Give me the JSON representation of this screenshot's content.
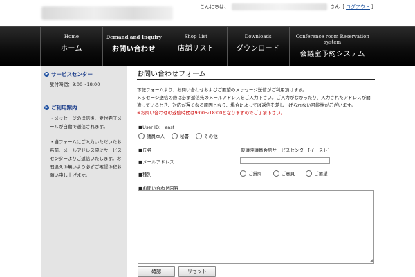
{
  "header": {
    "greeting_prefix": "こんにちは、",
    "greeting_suffix": "さん",
    "logout": "ログアウト"
  },
  "nav": [
    {
      "en": "Home",
      "jp": "ホーム",
      "active": false
    },
    {
      "en": "Demand and Inquiry",
      "jp": "お問い合わせ",
      "active": true
    },
    {
      "en": "Shop List",
      "jp": "店舗リスト",
      "active": false
    },
    {
      "en": "Downloads",
      "jp": "ダウンロード",
      "active": false
    },
    {
      "en": "Conference room Reservation system",
      "jp": "会議室予約システム",
      "active": false
    }
  ],
  "sidebar": {
    "service_center": {
      "title": "サービスセンター",
      "hours": "受付時間：9:00～18:00"
    },
    "guide": {
      "title": "ご利用案内",
      "note1": "・メッセージの送信後、受付完了メールが自動で送信されます。",
      "note2": "・当フォームにご入力いただいたお名前、メールアドレス宛にサービスセンターよりご返信いたします。お間違えの無いよう必ずご確認の程お願い申し上げます。"
    }
  },
  "form": {
    "title": "お問い合わせフォーム",
    "intro_line1": "下記フォームより、お問い合わせおよびご要望のメッセージ送信がご利用頂けます。",
    "intro_line2": "メッセージ送信の際は必ず返信先のメールアドレスをご入力下さい。ご入力がなかったり、入力されたアドレスが間違っているとき、対応が遅くなる原因となり、場合によっては返信を差し上げられない可能性がございます。",
    "intro_red": "※お問い合わせの返信時間は9:00～18:00となりますのでご了承下さい。",
    "user_id_label": "■User ID:",
    "user_id_value": "east",
    "user_type_options": [
      "議員本人",
      "秘書",
      "その他"
    ],
    "name_label": "■氏名",
    "name_value": "衆議院議員会館サービスセンター[イースト]",
    "email_label": "■メールアドレス",
    "email_value": "",
    "category_label": "■種別",
    "category_options": [
      "ご質問",
      "ご意見",
      "ご要望"
    ],
    "content_label": "■お問い合わせ内容",
    "content_value": "",
    "confirm_button": "確認",
    "reset_button": "リセット"
  }
}
